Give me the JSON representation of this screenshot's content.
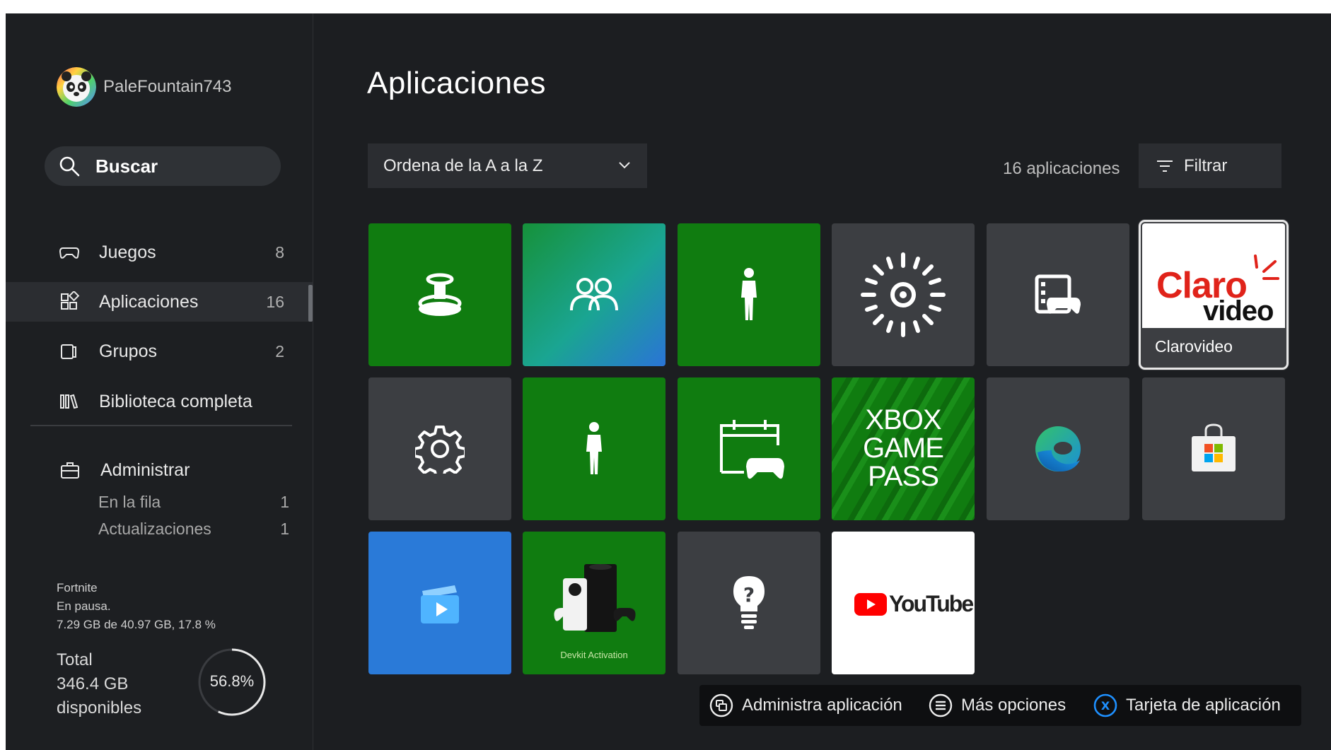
{
  "profile": {
    "gamertag": "PaleFountain743"
  },
  "search": {
    "label": "Buscar"
  },
  "nav": [
    {
      "label": "Juegos",
      "count": "8",
      "icon": "controller-icon"
    },
    {
      "label": "Aplicaciones",
      "count": "16",
      "icon": "apps-icon",
      "active": true
    },
    {
      "label": "Grupos",
      "count": "2",
      "icon": "groups-icon"
    },
    {
      "label": "Biblioteca completa",
      "count": "",
      "icon": "library-icon"
    }
  ],
  "manage": {
    "title": "Administrar",
    "items": [
      {
        "label": "En la fila",
        "count": "1"
      },
      {
        "label": "Actualizaciones",
        "count": "1"
      }
    ]
  },
  "download": {
    "game": "Fortnite",
    "status": "En pausa.",
    "progress_text": "7.29 GB de 40.97 GB, 17.8 %"
  },
  "storage": {
    "total_label": "Total",
    "free": "346.4 GB",
    "free_label": "disponibles",
    "percent_text": "56.8%",
    "percent": 56.8
  },
  "main": {
    "title": "Aplicaciones",
    "sort_label": "Ordena de la A a la Z",
    "count_label": "16 aplicaciones",
    "filter_label": "Filtrar"
  },
  "tiles": [
    {
      "icon": "accessories-icon",
      "bg": "green"
    },
    {
      "icon": "family-icon",
      "bg": "gradient-teal"
    },
    {
      "icon": "avatar-figure-icon",
      "bg": "green"
    },
    {
      "icon": "sunburst-icon",
      "bg": "gray"
    },
    {
      "icon": "game-clips-icon",
      "bg": "gray"
    },
    {
      "icon": "clarovideo-logo",
      "bg": "white",
      "caption": "Clarovideo",
      "logo_word": "Claro",
      "logo_sub": "video",
      "focused": true
    },
    {
      "icon": "settings-gear-icon",
      "bg": "gray"
    },
    {
      "icon": "avatar-editor-icon",
      "bg": "green"
    },
    {
      "icon": "events-calendar-icon",
      "bg": "green"
    },
    {
      "icon": "xbox-game-pass-logo",
      "bg": "green-stripes",
      "lines": [
        "XBOX",
        "GAME",
        "PASS"
      ]
    },
    {
      "icon": "edge-browser-icon",
      "bg": "gray"
    },
    {
      "icon": "microsoft-store-icon",
      "bg": "gray"
    },
    {
      "icon": "movies-tv-icon",
      "bg": "blue"
    },
    {
      "icon": "devkit-console-icon",
      "bg": "green",
      "caption": "Devkit Activation"
    },
    {
      "icon": "tips-lightbulb-icon",
      "bg": "gray"
    },
    {
      "icon": "youtube-logo",
      "bg": "white",
      "logo_word": "YouTube"
    }
  ],
  "hints": [
    {
      "icon": "view-button-icon",
      "label": "Administra aplicación"
    },
    {
      "icon": "menu-button-icon",
      "label": "Más opciones"
    },
    {
      "icon": "x-button-icon",
      "label": "Tarjeta de aplicación"
    }
  ],
  "colors": {
    "background": "#1c1e21",
    "xbox_green": "#107c10",
    "tile_gray": "#3c3e42",
    "claro_red": "#e0231a",
    "youtube_red": "#ff0000",
    "x_button_blue": "#1e90ff"
  }
}
